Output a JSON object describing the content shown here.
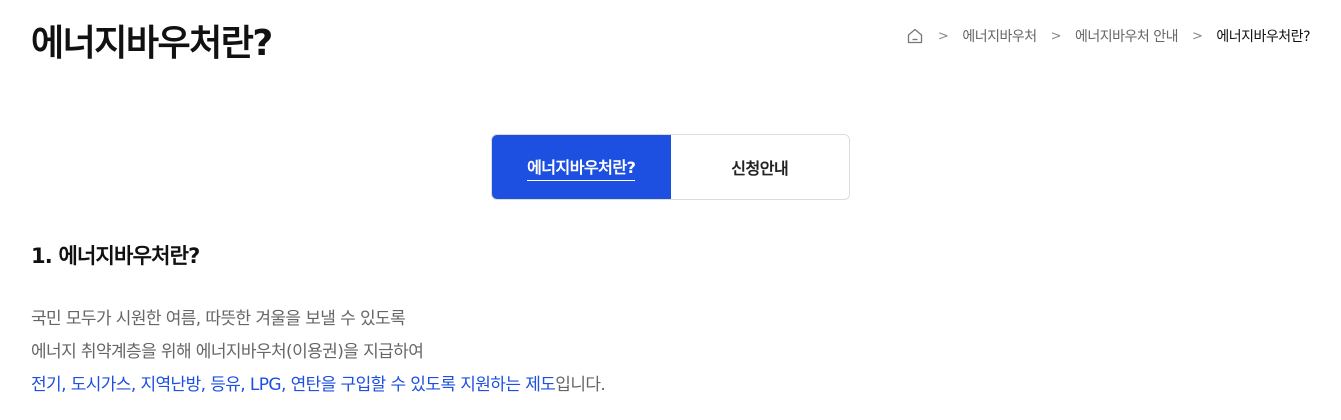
{
  "header": {
    "title": "에너지바우처란?"
  },
  "breadcrumb": {
    "home_icon": "home-icon",
    "items": [
      "에너지바우처",
      "에너지바우처 안내",
      "에너지바우처란?"
    ]
  },
  "tabs": [
    {
      "label": "에너지바우처란?",
      "active": true
    },
    {
      "label": "신청안내",
      "active": false
    }
  ],
  "section": {
    "heading": "1. 에너지바우처란?",
    "line1": "국민 모두가 시원한 여름, 따뜻한 겨울을 보낼 수 있도록",
    "line2": "에너지 취약계층을 위해 에너지바우처(이용권)을 지급하여",
    "line3_highlight": "전기, 도시가스, 지역난방, 등유, LPG, 연탄을 구입할 수 있도록 지원하는 제도",
    "line3_rest": "입니다."
  },
  "colors": {
    "accent": "#1d4fe0",
    "body_text": "#666666"
  }
}
